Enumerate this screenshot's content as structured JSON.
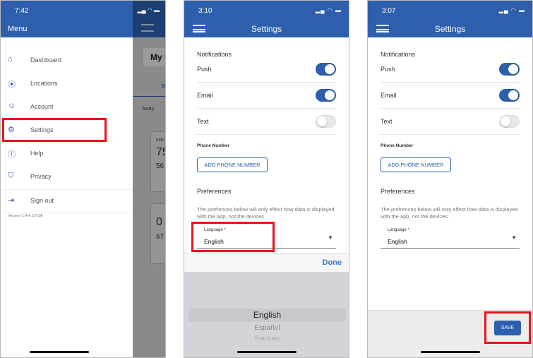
{
  "panel1": {
    "time": "7:42",
    "menu_title": "Menu",
    "items": [
      {
        "label": "Dashboard",
        "icon": "home-icon"
      },
      {
        "label": "Locations",
        "icon": "map-pin-icon"
      },
      {
        "label": "Account",
        "icon": "user-icon"
      },
      {
        "label": "Settings",
        "icon": "gear-icon"
      },
      {
        "label": "Help",
        "icon": "help-icon"
      },
      {
        "label": "Privacy",
        "icon": "shield-icon"
      },
      {
        "label": "Sign out",
        "icon": "sign-out-icon"
      }
    ],
    "version": "Version 1.4.4.13-QA",
    "background": {
      "title": "My l",
      "tab": "D",
      "away": "Away",
      "indoor": "Indo",
      "temp1": "75",
      "hum1": "56",
      "temp2": "0",
      "hum2": "67"
    }
  },
  "panel2": {
    "time": "3:10",
    "title": "Settings",
    "notifications": "Notifications",
    "push": "Push",
    "email": "Email",
    "text": "Text",
    "phone_number": "Phone Number",
    "add_phone": "ADD PHONE NUMBER",
    "preferences": "Preferences",
    "desc": "The prefrences below will only effect how data is displayed with the app, not the devices.",
    "language_label": "Language *",
    "language_value": "English",
    "done": "Done",
    "picker": [
      "English",
      "Español",
      "Français"
    ]
  },
  "panel3": {
    "time": "3:07",
    "title": "Settings",
    "notifications": "Notifications",
    "push": "Push",
    "email": "Email",
    "text": "Text",
    "phone_number": "Phone Number",
    "add_phone": "ADD PHONE NUMBER",
    "preferences": "Preferences",
    "desc": "The prefrences below will only effect how data is displayed with the app, not the devices.",
    "language_label": "Language *",
    "language_value": "English",
    "save": "SAVE"
  },
  "toggles": {
    "push": true,
    "email": true,
    "text": false
  },
  "colors": {
    "brand": "#2d5fad",
    "highlight": "#e8141b"
  }
}
